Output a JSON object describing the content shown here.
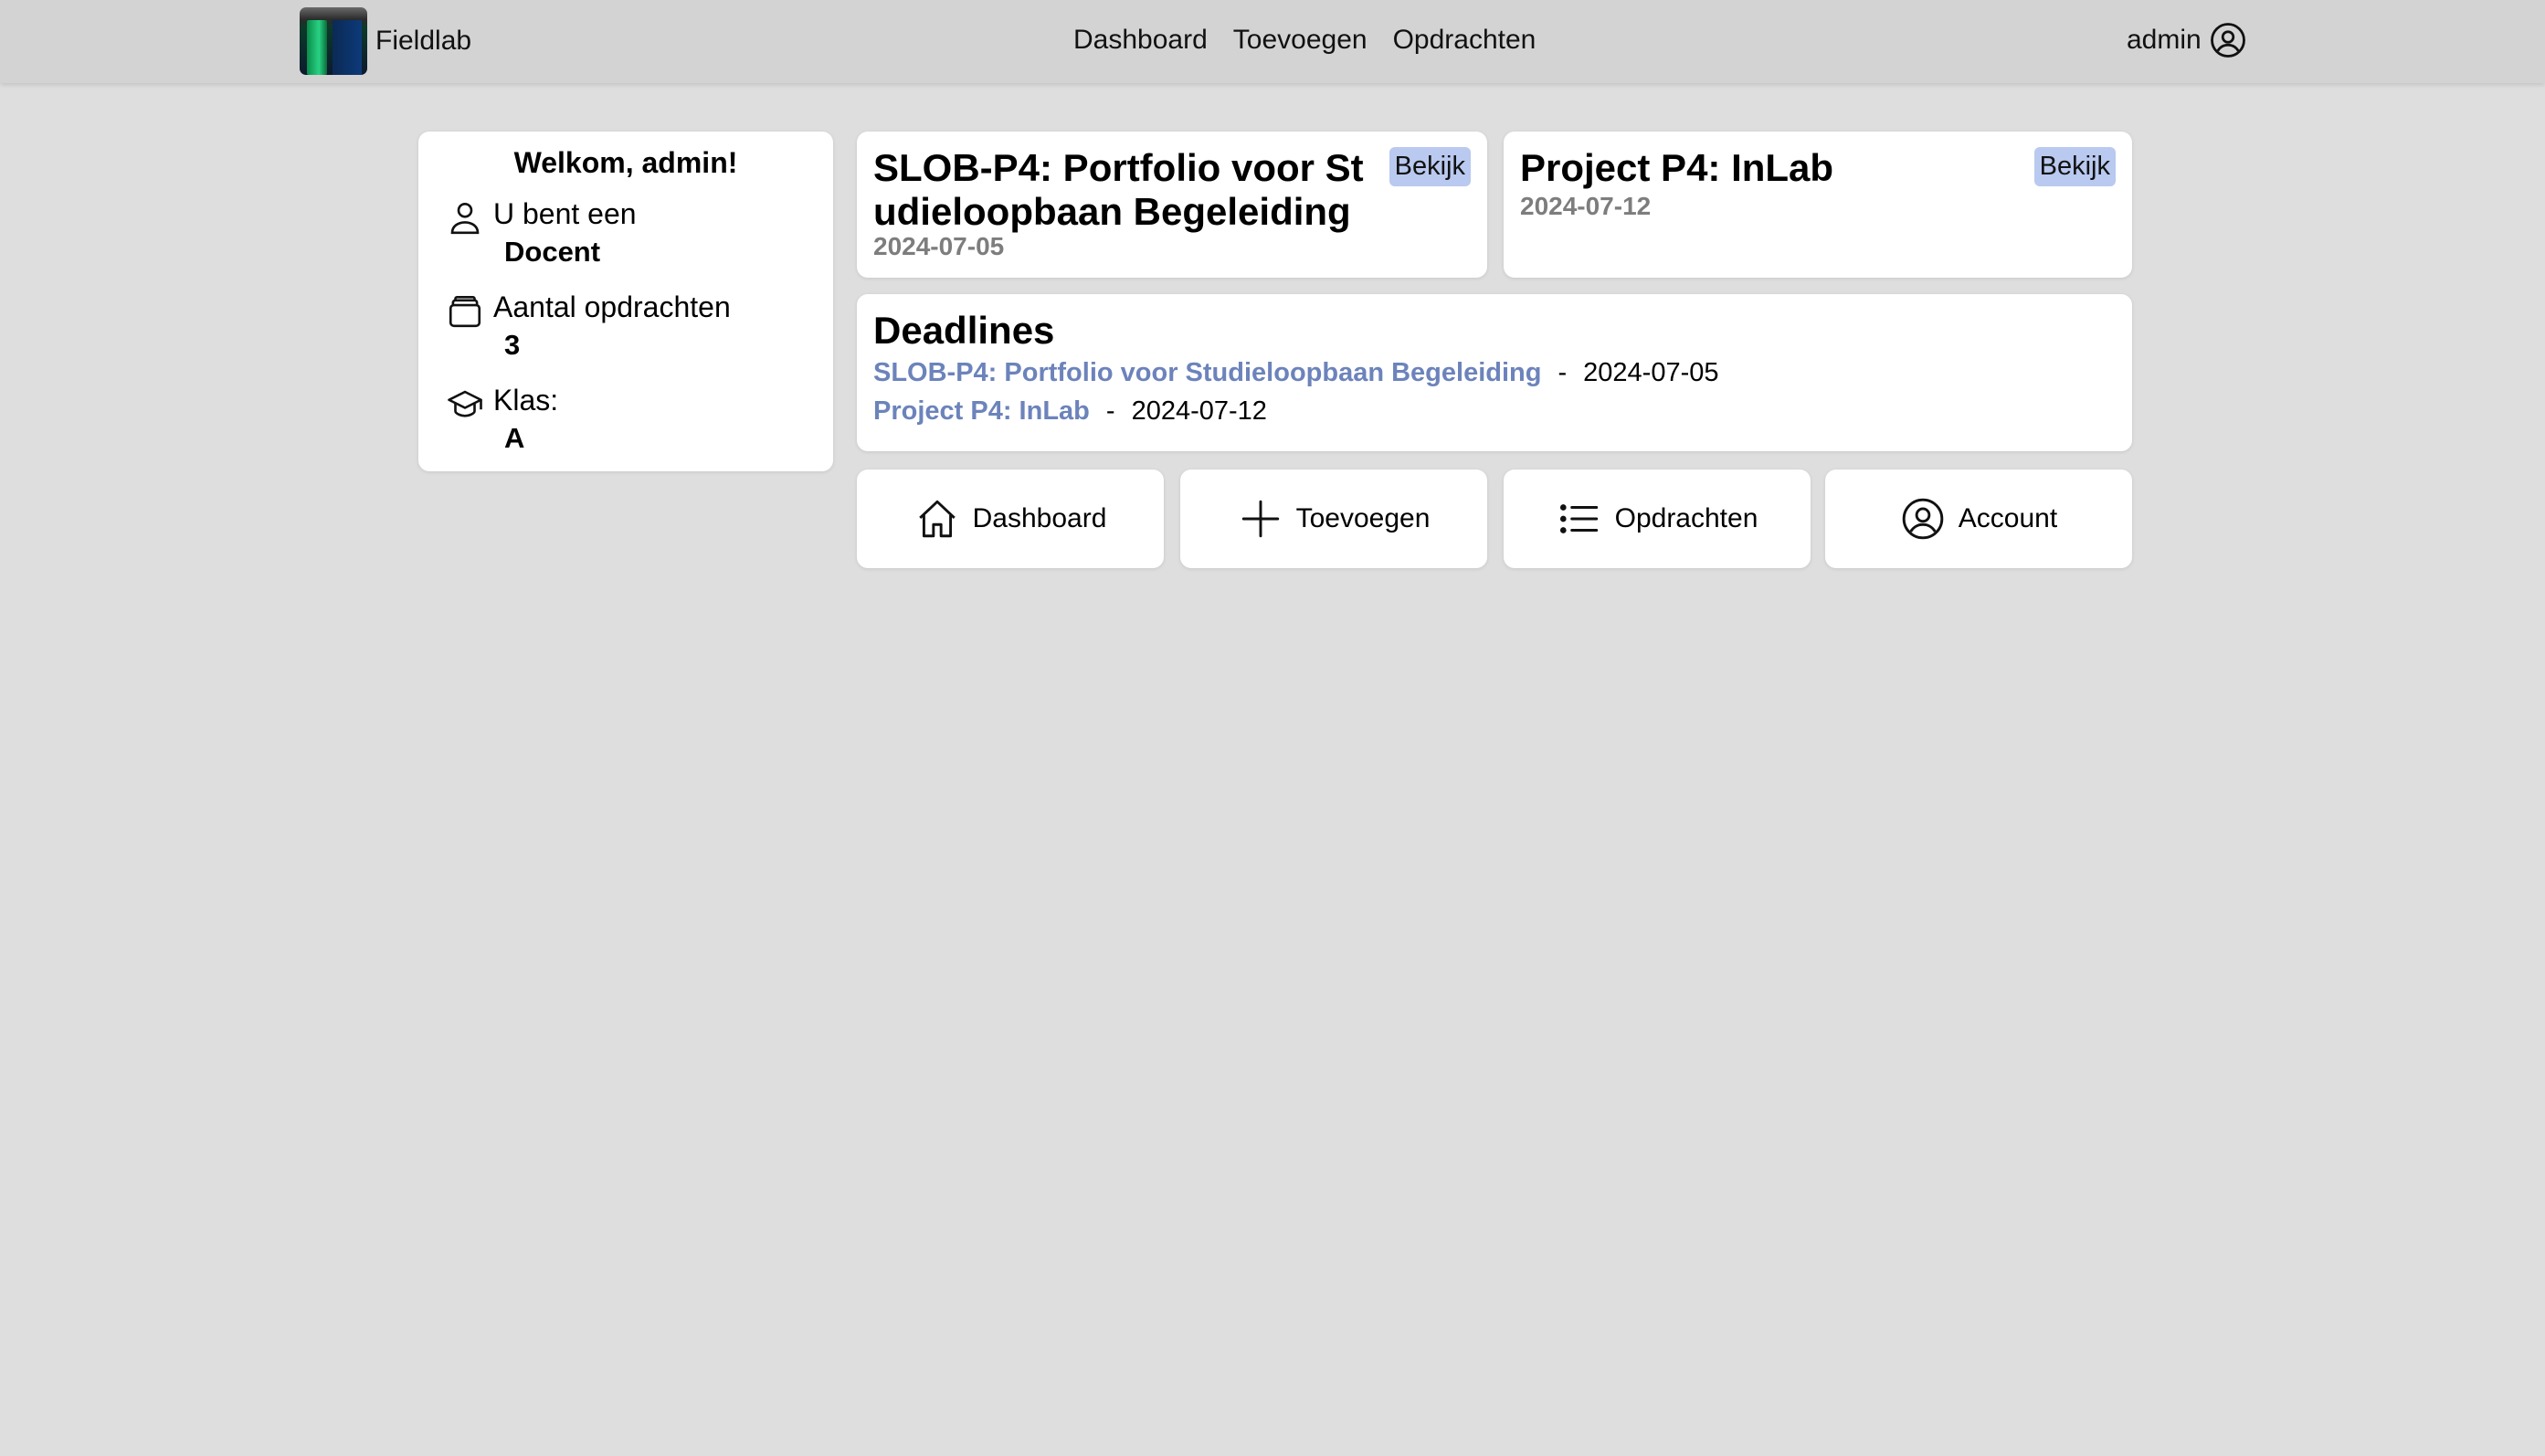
{
  "navbar": {
    "brand": "Fieldlab",
    "links": [
      "Dashboard",
      "Toevoegen",
      "Opdrachten"
    ],
    "user": "admin"
  },
  "welcome": {
    "title": "Welkom, admin!",
    "role_label": "U bent een",
    "role_value": "Docent",
    "count_label": "Aantal opdrachten",
    "count_value": "3",
    "class_label": "Klas:",
    "class_value": "A"
  },
  "assignments": [
    {
      "title": "SLOB-P4: Portfolio voor Studieloopbaan Begeleiding",
      "date": "2024-07-05",
      "button": "Bekijk"
    },
    {
      "title": "Project P4: InLab",
      "date": "2024-07-12",
      "button": "Bekijk"
    }
  ],
  "deadlines": {
    "title": "Deadlines",
    "items": [
      {
        "name": "SLOB-P4: Portfolio voor Studieloopbaan Begeleiding",
        "separator": "-",
        "date": "2024-07-05"
      },
      {
        "name": "Project P4: InLab",
        "separator": "-",
        "date": "2024-07-12"
      }
    ]
  },
  "quick_links": [
    {
      "label": "Dashboard",
      "icon": "home-icon"
    },
    {
      "label": "Toevoegen",
      "icon": "plus-icon"
    },
    {
      "label": "Opdrachten",
      "icon": "list-icon"
    },
    {
      "label": "Account",
      "icon": "user-circle-icon"
    }
  ],
  "colors": {
    "page_background": "#dedede",
    "navbar_background": "#d3d3d3",
    "badge_background": "#b9c9ef",
    "deadline_link": "#6c83bb",
    "muted_date": "#7d7d7d"
  }
}
